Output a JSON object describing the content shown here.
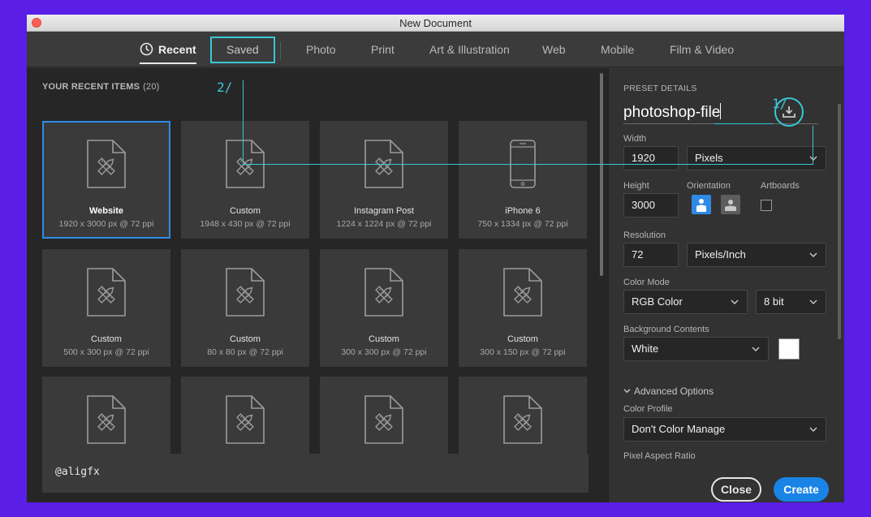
{
  "window": {
    "title": "New Document"
  },
  "tabs": [
    {
      "label": "Recent",
      "active": true
    },
    {
      "label": "Saved",
      "highlighted": true
    },
    {
      "label": "Photo"
    },
    {
      "label": "Print"
    },
    {
      "label": "Art & Illustration"
    },
    {
      "label": "Web"
    },
    {
      "label": "Mobile"
    },
    {
      "label": "Film & Video"
    }
  ],
  "recent": {
    "header": "YOUR RECENT ITEMS",
    "count": "(20)",
    "items": [
      {
        "name": "Website",
        "dims": "1920 x 3000 px @ 72 ppi",
        "icon": "document-icon",
        "selected": true
      },
      {
        "name": "Custom",
        "dims": "1948 x 430 px @ 72 ppi",
        "icon": "document-icon"
      },
      {
        "name": "Instagram Post",
        "dims": "1224 x 1224 px @ 72 ppi",
        "icon": "document-icon"
      },
      {
        "name": "iPhone 6",
        "dims": "750 x 1334 px @ 72 ppi",
        "icon": "phone-icon"
      },
      {
        "name": "Custom",
        "dims": "500 x 300 px @ 72 ppi",
        "icon": "document-icon"
      },
      {
        "name": "Custom",
        "dims": "80 x 80 px @ 72 ppi",
        "icon": "document-icon"
      },
      {
        "name": "Custom",
        "dims": "300 x 300 px @ 72 ppi",
        "icon": "document-icon"
      },
      {
        "name": "Custom",
        "dims": "300 x 150 px @ 72 ppi",
        "icon": "document-icon"
      },
      {
        "name": "",
        "dims": "",
        "icon": "document-icon"
      },
      {
        "name": "",
        "dims": "",
        "icon": "document-icon"
      },
      {
        "name": "",
        "dims": "",
        "icon": "document-icon"
      },
      {
        "name": "",
        "dims": "",
        "icon": "document-icon"
      }
    ]
  },
  "bottom_bar": {
    "text": "@aligfx"
  },
  "preset": {
    "section_label": "PRESET DETAILS",
    "name": "photoshop-file",
    "width_label": "Width",
    "width_value": "1920",
    "width_unit": "Pixels",
    "height_label": "Height",
    "height_value": "3000",
    "orientation_label": "Orientation",
    "orientation": "portrait",
    "artboards_label": "Artboards",
    "artboards_checked": false,
    "resolution_label": "Resolution",
    "resolution_value": "72",
    "resolution_unit": "Pixels/Inch",
    "color_mode_label": "Color Mode",
    "color_mode": "RGB Color",
    "bit_depth": "8 bit",
    "background_label": "Background Contents",
    "background": "White",
    "background_color": "#ffffff",
    "advanced_label": "Advanced Options",
    "color_profile_label": "Color Profile",
    "color_profile": "Don't Color Manage",
    "pixel_aspect_label": "Pixel Aspect Ratio"
  },
  "buttons": {
    "close": "Close",
    "create": "Create"
  },
  "annotations": {
    "one": "1/",
    "two": "2/"
  },
  "colors": {
    "accent": "#2e8ae6",
    "annotation": "#38c7d6",
    "background": "#5a1ee6"
  }
}
